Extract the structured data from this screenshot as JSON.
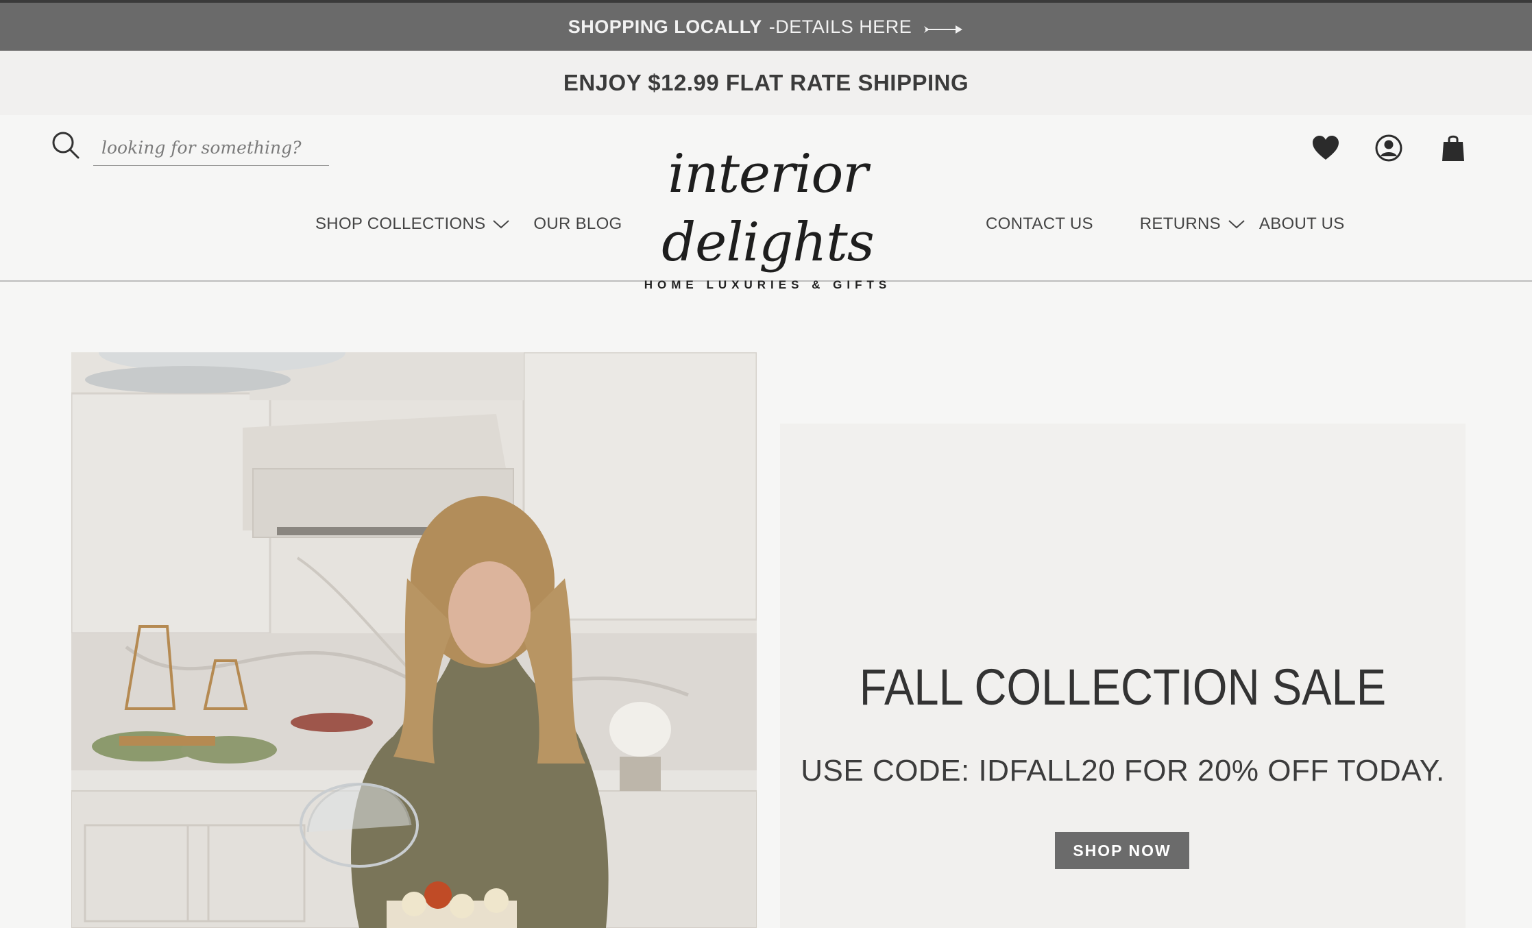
{
  "promo": {
    "bold_text": "SHOPPING LOCALLY",
    "link_text": "-DETAILS HERE",
    "arrow_icon": "arrow-right-icon"
  },
  "shipping": {
    "text": "ENJOY $12.99 FLAT RATE SHIPPING"
  },
  "search": {
    "placeholder": "looking for something?",
    "icon": "search-icon"
  },
  "logo": {
    "script_text": "interior delights",
    "tagline": "HOME LUXURIES & GIFTS"
  },
  "nav": {
    "left": [
      {
        "label": "SHOP COLLECTIONS",
        "has_dropdown": true
      },
      {
        "label": "OUR BLOG",
        "has_dropdown": false
      }
    ],
    "right": [
      {
        "label": "CONTACT US",
        "has_dropdown": false
      },
      {
        "label": "RETURNS",
        "has_dropdown": true
      },
      {
        "label": "ABOUT US",
        "has_dropdown": false
      }
    ]
  },
  "header_icons": [
    "heart-icon",
    "account-icon",
    "shopping-bag-icon"
  ],
  "hero": {
    "title": "FALL COLLECTION SALE",
    "code_text": "USE CODE: IDFALL20 FOR 20% OFF TODAY.",
    "button_label": "SHOP NOW"
  },
  "colors": {
    "promo_bg": "#6a6a6a",
    "shipping_bg": "#f1f0ef",
    "page_bg": "#f6f6f5",
    "button_bg": "#6b6b6b",
    "text_dark": "#333333"
  }
}
